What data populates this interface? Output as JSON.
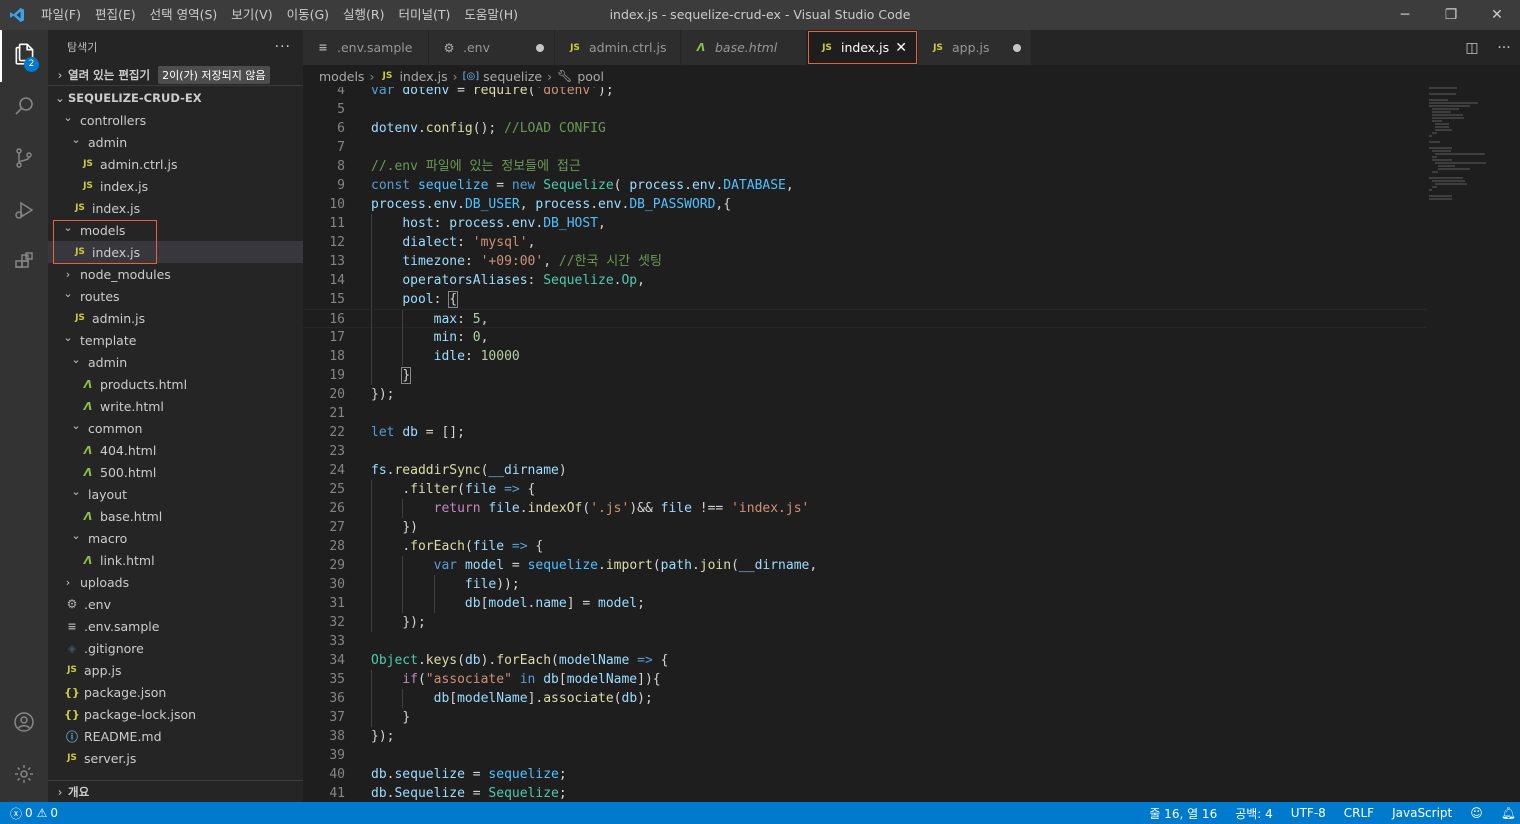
{
  "window": {
    "title": "index.js - sequelize-crud-ex - Visual Studio Code",
    "menu": [
      "파일(F)",
      "편집(E)",
      "선택 영역(S)",
      "보기(V)",
      "이동(G)",
      "실행(R)",
      "터미널(T)",
      "도움말(H)"
    ],
    "controls": {
      "minimize": "─",
      "restore": "❐",
      "close": "✕"
    }
  },
  "activity_bar": {
    "icons": [
      "files-icon",
      "search-icon",
      "source-control-icon",
      "run-debug-icon",
      "extensions-icon"
    ],
    "explorer_badge": "2",
    "bottom_icons": [
      "account-icon",
      "settings-gear-icon"
    ]
  },
  "sidebar": {
    "title": "탐색기",
    "more": "···",
    "open_editors": {
      "label": "열려 있는 편집기",
      "badge": "2이(가) 저장되지 않음"
    },
    "project": {
      "label": "SEQUELIZE-CRUD-EX"
    },
    "tree": [
      {
        "depth": 0,
        "type": "folder",
        "open": true,
        "label": "controllers"
      },
      {
        "depth": 1,
        "type": "folder",
        "open": true,
        "label": "admin"
      },
      {
        "depth": 2,
        "type": "js",
        "label": "admin.ctrl.js"
      },
      {
        "depth": 2,
        "type": "js",
        "label": "index.js"
      },
      {
        "depth": 1,
        "type": "js",
        "label": "index.js"
      },
      {
        "depth": 0,
        "type": "folder",
        "open": true,
        "label": "models"
      },
      {
        "depth": 1,
        "type": "js",
        "label": "index.js",
        "selected": true
      },
      {
        "depth": 0,
        "type": "folder",
        "open": false,
        "label": "node_modules"
      },
      {
        "depth": 0,
        "type": "folder",
        "open": true,
        "label": "routes"
      },
      {
        "depth": 1,
        "type": "js",
        "label": "admin.js"
      },
      {
        "depth": 0,
        "type": "folder",
        "open": true,
        "label": "template"
      },
      {
        "depth": 1,
        "type": "folder",
        "open": true,
        "label": "admin"
      },
      {
        "depth": 2,
        "type": "html",
        "label": "products.html"
      },
      {
        "depth": 2,
        "type": "html",
        "label": "write.html"
      },
      {
        "depth": 1,
        "type": "folder",
        "open": true,
        "label": "common"
      },
      {
        "depth": 2,
        "type": "html",
        "label": "404.html"
      },
      {
        "depth": 2,
        "type": "html",
        "label": "500.html"
      },
      {
        "depth": 1,
        "type": "folder",
        "open": true,
        "label": "layout"
      },
      {
        "depth": 2,
        "type": "html",
        "label": "base.html"
      },
      {
        "depth": 1,
        "type": "folder",
        "open": true,
        "label": "macro"
      },
      {
        "depth": 2,
        "type": "html",
        "label": "link.html"
      },
      {
        "depth": 0,
        "type": "folder",
        "open": false,
        "label": "uploads"
      },
      {
        "depth": 0,
        "type": "gear",
        "label": ".env"
      },
      {
        "depth": 0,
        "type": "lines",
        "label": ".env.sample"
      },
      {
        "depth": 0,
        "type": "diamond",
        "label": ".gitignore"
      },
      {
        "depth": 0,
        "type": "js",
        "label": "app.js"
      },
      {
        "depth": 0,
        "type": "json",
        "label": "package.json"
      },
      {
        "depth": 0,
        "type": "json",
        "label": "package-lock.json"
      },
      {
        "depth": 0,
        "type": "info",
        "label": "README.md"
      },
      {
        "depth": 0,
        "type": "js",
        "label": "server.js"
      }
    ],
    "outline": {
      "label": "개요"
    }
  },
  "tabs": [
    {
      "label": ".env.sample",
      "icon": "lines",
      "state": "none",
      "italic": false
    },
    {
      "label": ".env",
      "icon": "gear",
      "state": "dirty",
      "italic": false
    },
    {
      "label": "admin.ctrl.js",
      "icon": "js",
      "state": "none",
      "italic": false
    },
    {
      "label": "base.html",
      "icon": "html",
      "state": "none",
      "italic": true
    },
    {
      "label": "index.js",
      "icon": "js",
      "state": "close",
      "italic": false,
      "active": true
    },
    {
      "label": "app.js",
      "icon": "js",
      "state": "dirty",
      "italic": false
    }
  ],
  "icon_glyphs": {
    "js": "JS",
    "html": "Λ",
    "json": "{}",
    "gear": "⚙",
    "lines": "≡",
    "diamond": "◈",
    "info": "ⓘ"
  },
  "breadcrumb": {
    "folder": "models",
    "file": "index.js",
    "symbol1": "sequelize",
    "symbol2": "pool"
  },
  "code": {
    "current_line": 16,
    "lines": [
      {
        "n": 4,
        "tokens": [
          [
            "var",
            "kw"
          ],
          [
            " ",
            ""
          ],
          [
            "dotenv",
            "var"
          ],
          [
            " = ",
            ""
          ],
          [
            "require",
            "fn"
          ],
          [
            "(",
            ""
          ],
          [
            "'dotenv'",
            "str"
          ],
          [
            ");",
            ""
          ]
        ]
      },
      {
        "n": 5,
        "tokens": []
      },
      {
        "n": 6,
        "tokens": [
          [
            "dotenv",
            "var"
          ],
          [
            ".",
            ""
          ],
          [
            "config",
            "fn"
          ],
          [
            "(); ",
            ""
          ],
          [
            "//LOAD CONFIG",
            "cm"
          ]
        ]
      },
      {
        "n": 7,
        "tokens": []
      },
      {
        "n": 8,
        "tokens": [
          [
            "//.env 파일에 있는 정보들에 접근",
            "cm"
          ]
        ]
      },
      {
        "n": 9,
        "tokens": [
          [
            "const",
            "kw"
          ],
          [
            " ",
            ""
          ],
          [
            "sequelize",
            "cst"
          ],
          [
            " = ",
            ""
          ],
          [
            "new",
            "kw"
          ],
          [
            " ",
            ""
          ],
          [
            "Sequelize",
            "cls"
          ],
          [
            "( ",
            ""
          ],
          [
            "process",
            "var"
          ],
          [
            ".",
            ""
          ],
          [
            "env",
            "var"
          ],
          [
            ".",
            ""
          ],
          [
            "DATABASE",
            "cst"
          ],
          [
            ",",
            ""
          ]
        ]
      },
      {
        "n": 10,
        "tokens": [
          [
            "process",
            "var"
          ],
          [
            ".",
            ""
          ],
          [
            "env",
            "var"
          ],
          [
            ".",
            ""
          ],
          [
            "DB_USER",
            "cst"
          ],
          [
            ", ",
            ""
          ],
          [
            "process",
            "var"
          ],
          [
            ".",
            ""
          ],
          [
            "env",
            "var"
          ],
          [
            ".",
            ""
          ],
          [
            "DB_PASSWORD",
            "cst"
          ],
          [
            ",{",
            ""
          ]
        ]
      },
      {
        "n": 11,
        "indent": 1,
        "tokens": [
          [
            "host",
            "var"
          ],
          [
            ": ",
            ""
          ],
          [
            "process",
            "var"
          ],
          [
            ".",
            ""
          ],
          [
            "env",
            "var"
          ],
          [
            ".",
            ""
          ],
          [
            "DB_HOST",
            "cst"
          ],
          [
            ",",
            ""
          ]
        ]
      },
      {
        "n": 12,
        "indent": 1,
        "tokens": [
          [
            "dialect",
            "var"
          ],
          [
            ": ",
            ""
          ],
          [
            "'mysql'",
            "str"
          ],
          [
            ",",
            ""
          ]
        ]
      },
      {
        "n": 13,
        "indent": 1,
        "tokens": [
          [
            "timezone",
            "var"
          ],
          [
            ": ",
            ""
          ],
          [
            "'+09:00'",
            "str"
          ],
          [
            ", ",
            ""
          ],
          [
            "//한국 시간 셋팅",
            "cm"
          ]
        ]
      },
      {
        "n": 14,
        "indent": 1,
        "tokens": [
          [
            "operatorsAliases",
            "var"
          ],
          [
            ": ",
            ""
          ],
          [
            "Sequelize",
            "cls"
          ],
          [
            ".",
            ""
          ],
          [
            "Op",
            "cls"
          ],
          [
            ",",
            ""
          ]
        ]
      },
      {
        "n": 15,
        "indent": 1,
        "tokens": [
          [
            "pool",
            "var"
          ],
          [
            ": ",
            ""
          ],
          [
            "{",
            "br"
          ]
        ]
      },
      {
        "n": 16,
        "indent": 2,
        "tokens": [
          [
            "max",
            "var"
          ],
          [
            ": ",
            ""
          ],
          [
            "5",
            "num"
          ],
          [
            ",",
            ""
          ]
        ]
      },
      {
        "n": 17,
        "indent": 2,
        "tokens": [
          [
            "min",
            "var"
          ],
          [
            ": ",
            ""
          ],
          [
            "0",
            "num"
          ],
          [
            ",",
            ""
          ]
        ]
      },
      {
        "n": 18,
        "indent": 2,
        "tokens": [
          [
            "idle",
            "var"
          ],
          [
            ": ",
            ""
          ],
          [
            "10000",
            "num"
          ]
        ]
      },
      {
        "n": 19,
        "indent": 1,
        "tokens": [
          [
            "}",
            "br"
          ]
        ]
      },
      {
        "n": 20,
        "tokens": [
          [
            "});",
            ""
          ]
        ]
      },
      {
        "n": 21,
        "tokens": []
      },
      {
        "n": 22,
        "tokens": [
          [
            "let",
            "kw"
          ],
          [
            " ",
            ""
          ],
          [
            "db",
            "var"
          ],
          [
            " = [];",
            ""
          ]
        ]
      },
      {
        "n": 23,
        "tokens": []
      },
      {
        "n": 24,
        "tokens": [
          [
            "fs",
            "var"
          ],
          [
            ".",
            ""
          ],
          [
            "readdirSync",
            "fn"
          ],
          [
            "(",
            ""
          ],
          [
            "__dirname",
            "var"
          ],
          [
            ")",
            ""
          ]
        ]
      },
      {
        "n": 25,
        "indent": 1,
        "tokens": [
          [
            ".",
            ""
          ],
          [
            "filter",
            "fn"
          ],
          [
            "(",
            ""
          ],
          [
            "file",
            "var"
          ],
          [
            " ",
            ""
          ],
          [
            "=>",
            "kw"
          ],
          [
            " {",
            ""
          ]
        ]
      },
      {
        "n": 26,
        "indent": 2,
        "tokens": [
          [
            "return",
            "ctl"
          ],
          [
            " ",
            ""
          ],
          [
            "file",
            "var"
          ],
          [
            ".",
            ""
          ],
          [
            "indexOf",
            "fn"
          ],
          [
            "(",
            ""
          ],
          [
            "'.js'",
            "str"
          ],
          [
            ")&& ",
            ""
          ],
          [
            "file",
            "var"
          ],
          [
            " !== ",
            ""
          ],
          [
            "'index.js'",
            "str"
          ]
        ]
      },
      {
        "n": 27,
        "indent": 1,
        "tokens": [
          [
            "})",
            ""
          ]
        ]
      },
      {
        "n": 28,
        "indent": 1,
        "tokens": [
          [
            ".",
            ""
          ],
          [
            "forEach",
            "fn"
          ],
          [
            "(",
            ""
          ],
          [
            "file",
            "var"
          ],
          [
            " ",
            ""
          ],
          [
            "=>",
            "kw"
          ],
          [
            " {",
            ""
          ]
        ]
      },
      {
        "n": 29,
        "indent": 2,
        "tokens": [
          [
            "var",
            "kw"
          ],
          [
            " ",
            ""
          ],
          [
            "model",
            "var"
          ],
          [
            " = ",
            ""
          ],
          [
            "sequelize",
            "cst"
          ],
          [
            ".",
            ""
          ],
          [
            "import",
            "fn"
          ],
          [
            "(",
            ""
          ],
          [
            "path",
            "var"
          ],
          [
            ".",
            ""
          ],
          [
            "join",
            "fn"
          ],
          [
            "(",
            ""
          ],
          [
            "__dirname",
            "var"
          ],
          [
            ",",
            ""
          ]
        ]
      },
      {
        "n": 30,
        "indent": 3,
        "tokens": [
          [
            "file",
            "var"
          ],
          [
            "));",
            ""
          ]
        ]
      },
      {
        "n": 31,
        "indent": 3,
        "tokens": [
          [
            "db",
            "var"
          ],
          [
            "[",
            ""
          ],
          [
            "model",
            "var"
          ],
          [
            ".",
            ""
          ],
          [
            "name",
            "var"
          ],
          [
            "] = ",
            ""
          ],
          [
            "model",
            "var"
          ],
          [
            ";",
            ""
          ]
        ]
      },
      {
        "n": 32,
        "indent": 1,
        "tokens": [
          [
            "});",
            ""
          ]
        ]
      },
      {
        "n": 33,
        "tokens": []
      },
      {
        "n": 34,
        "tokens": [
          [
            "Object",
            "cls"
          ],
          [
            ".",
            ""
          ],
          [
            "keys",
            "fn"
          ],
          [
            "(",
            ""
          ],
          [
            "db",
            "var"
          ],
          [
            ").",
            ""
          ],
          [
            "forEach",
            "fn"
          ],
          [
            "(",
            ""
          ],
          [
            "modelName",
            "var"
          ],
          [
            " ",
            ""
          ],
          [
            "=>",
            "kw"
          ],
          [
            " {",
            ""
          ]
        ]
      },
      {
        "n": 35,
        "indent": 1,
        "tokens": [
          [
            "if",
            "ctl"
          ],
          [
            "(",
            ""
          ],
          [
            "\"associate\"",
            "str"
          ],
          [
            " ",
            ""
          ],
          [
            "in",
            "kw"
          ],
          [
            " ",
            ""
          ],
          [
            "db",
            "var"
          ],
          [
            "[",
            ""
          ],
          [
            "modelName",
            "var"
          ],
          [
            "]){",
            ""
          ]
        ]
      },
      {
        "n": 36,
        "indent": 2,
        "tokens": [
          [
            "db",
            "var"
          ],
          [
            "[",
            ""
          ],
          [
            "modelName",
            "var"
          ],
          [
            "].",
            ""
          ],
          [
            "associate",
            "fn"
          ],
          [
            "(",
            ""
          ],
          [
            "db",
            "var"
          ],
          [
            ");",
            ""
          ]
        ]
      },
      {
        "n": 37,
        "indent": 1,
        "tokens": [
          [
            "}",
            ""
          ]
        ]
      },
      {
        "n": 38,
        "tokens": [
          [
            "});",
            ""
          ]
        ]
      },
      {
        "n": 39,
        "tokens": []
      },
      {
        "n": 40,
        "tokens": [
          [
            "db",
            "var"
          ],
          [
            ".",
            ""
          ],
          [
            "sequelize",
            "var"
          ],
          [
            " = ",
            ""
          ],
          [
            "sequelize",
            "cst"
          ],
          [
            ";",
            ""
          ]
        ]
      },
      {
        "n": 41,
        "tokens": [
          [
            "db",
            "var"
          ],
          [
            ".",
            ""
          ],
          [
            "Sequelize",
            "var"
          ],
          [
            " = ",
            ""
          ],
          [
            "Sequelize",
            "cls"
          ],
          [
            ";",
            ""
          ]
        ]
      }
    ]
  },
  "token_colors": {
    "kw": "#569cd6",
    "var": "#9cdcfe",
    "fn": "#dcdcaa",
    "str": "#ce9178",
    "cm": "#6a9955",
    "cst": "#4fc1ff",
    "cls": "#4ec9b0",
    "num": "#b5cea8",
    "ctl": "#c586c0",
    "br": "#d4d4d4"
  },
  "status_bar": {
    "errors": "0",
    "warnings": "0",
    "position": "줄 16, 열 16",
    "spaces": "공백: 4",
    "encoding": "UTF-8",
    "eol": "CRLF",
    "language": "JavaScript"
  }
}
